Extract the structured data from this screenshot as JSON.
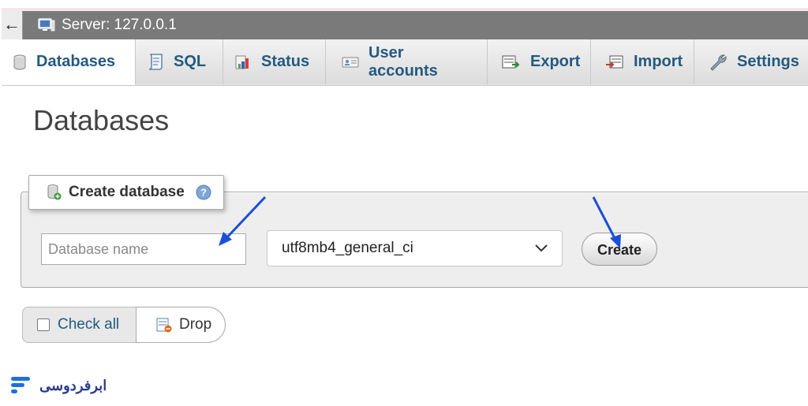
{
  "server_bar": {
    "label": "Server: 127.0.0.1"
  },
  "tabs": [
    {
      "label": "Databases",
      "icon": "database-icon",
      "active": true
    },
    {
      "label": "SQL",
      "icon": "sql-icon"
    },
    {
      "label": "Status",
      "icon": "status-icon"
    },
    {
      "label": "User accounts",
      "icon": "user-accounts-icon"
    },
    {
      "label": "Export",
      "icon": "export-icon"
    },
    {
      "label": "Import",
      "icon": "import-icon"
    },
    {
      "label": "Settings",
      "icon": "wrench-icon"
    }
  ],
  "page": {
    "title": "Databases"
  },
  "create_database": {
    "legend": "Create database",
    "name_placeholder": "Database name",
    "name_value": "",
    "collation_selected": "utf8mb4_general_ci",
    "create_label": "Create"
  },
  "bulk": {
    "check_all_label": "Check all",
    "drop_label": "Drop"
  },
  "brand": {
    "text": "ابرفردوسی"
  },
  "colors": {
    "link": "#235a81",
    "arrow": "#1a4fd6",
    "brand": "#2b3b8c"
  }
}
